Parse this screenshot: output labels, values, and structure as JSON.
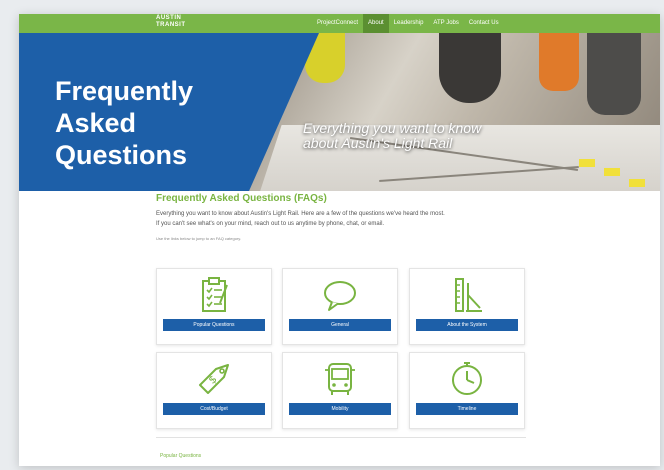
{
  "nav": {
    "logo_line1": "AUSTIN",
    "logo_line2": "TRANSIT",
    "links": [
      "ProjectConnect",
      "About",
      "Leadership",
      "ATP Jobs",
      "Contact Us"
    ],
    "active_link": "About",
    "accent_color": "#7ab648"
  },
  "hero": {
    "title_line1": "Frequently",
    "title_line2": "Asked",
    "title_line3": "Questions",
    "tagline_line1": "Everything you want to know",
    "tagline_line2": "about Austin's Light Rail",
    "panel_color": "#1d5fa8"
  },
  "faq": {
    "heading": "Frequently Asked Questions (FAQs)",
    "intro_line1": "Everything you want to know about Austin's Light Rail. Here are a few of the questions we've heard the most.",
    "intro_line2": "If you can't see what's on your mind, reach out to us anytime by phone, chat, or email.",
    "hint": "Use the links below to jump to an FAQ category.",
    "heading_color": "#79b441"
  },
  "categories": [
    {
      "label": "Popular Questions",
      "icon": "clipboard-checklist-icon"
    },
    {
      "label": "General",
      "icon": "speech-bubble-icon"
    },
    {
      "label": "About the System",
      "icon": "ruler-drafting-icon"
    },
    {
      "label": "Cost/Budget",
      "icon": "price-tag-icon"
    },
    {
      "label": "Mobility",
      "icon": "bus-icon"
    },
    {
      "label": "Timeline",
      "icon": "clock-icon"
    }
  ],
  "footer": {
    "section_link": "Popular Questions"
  }
}
